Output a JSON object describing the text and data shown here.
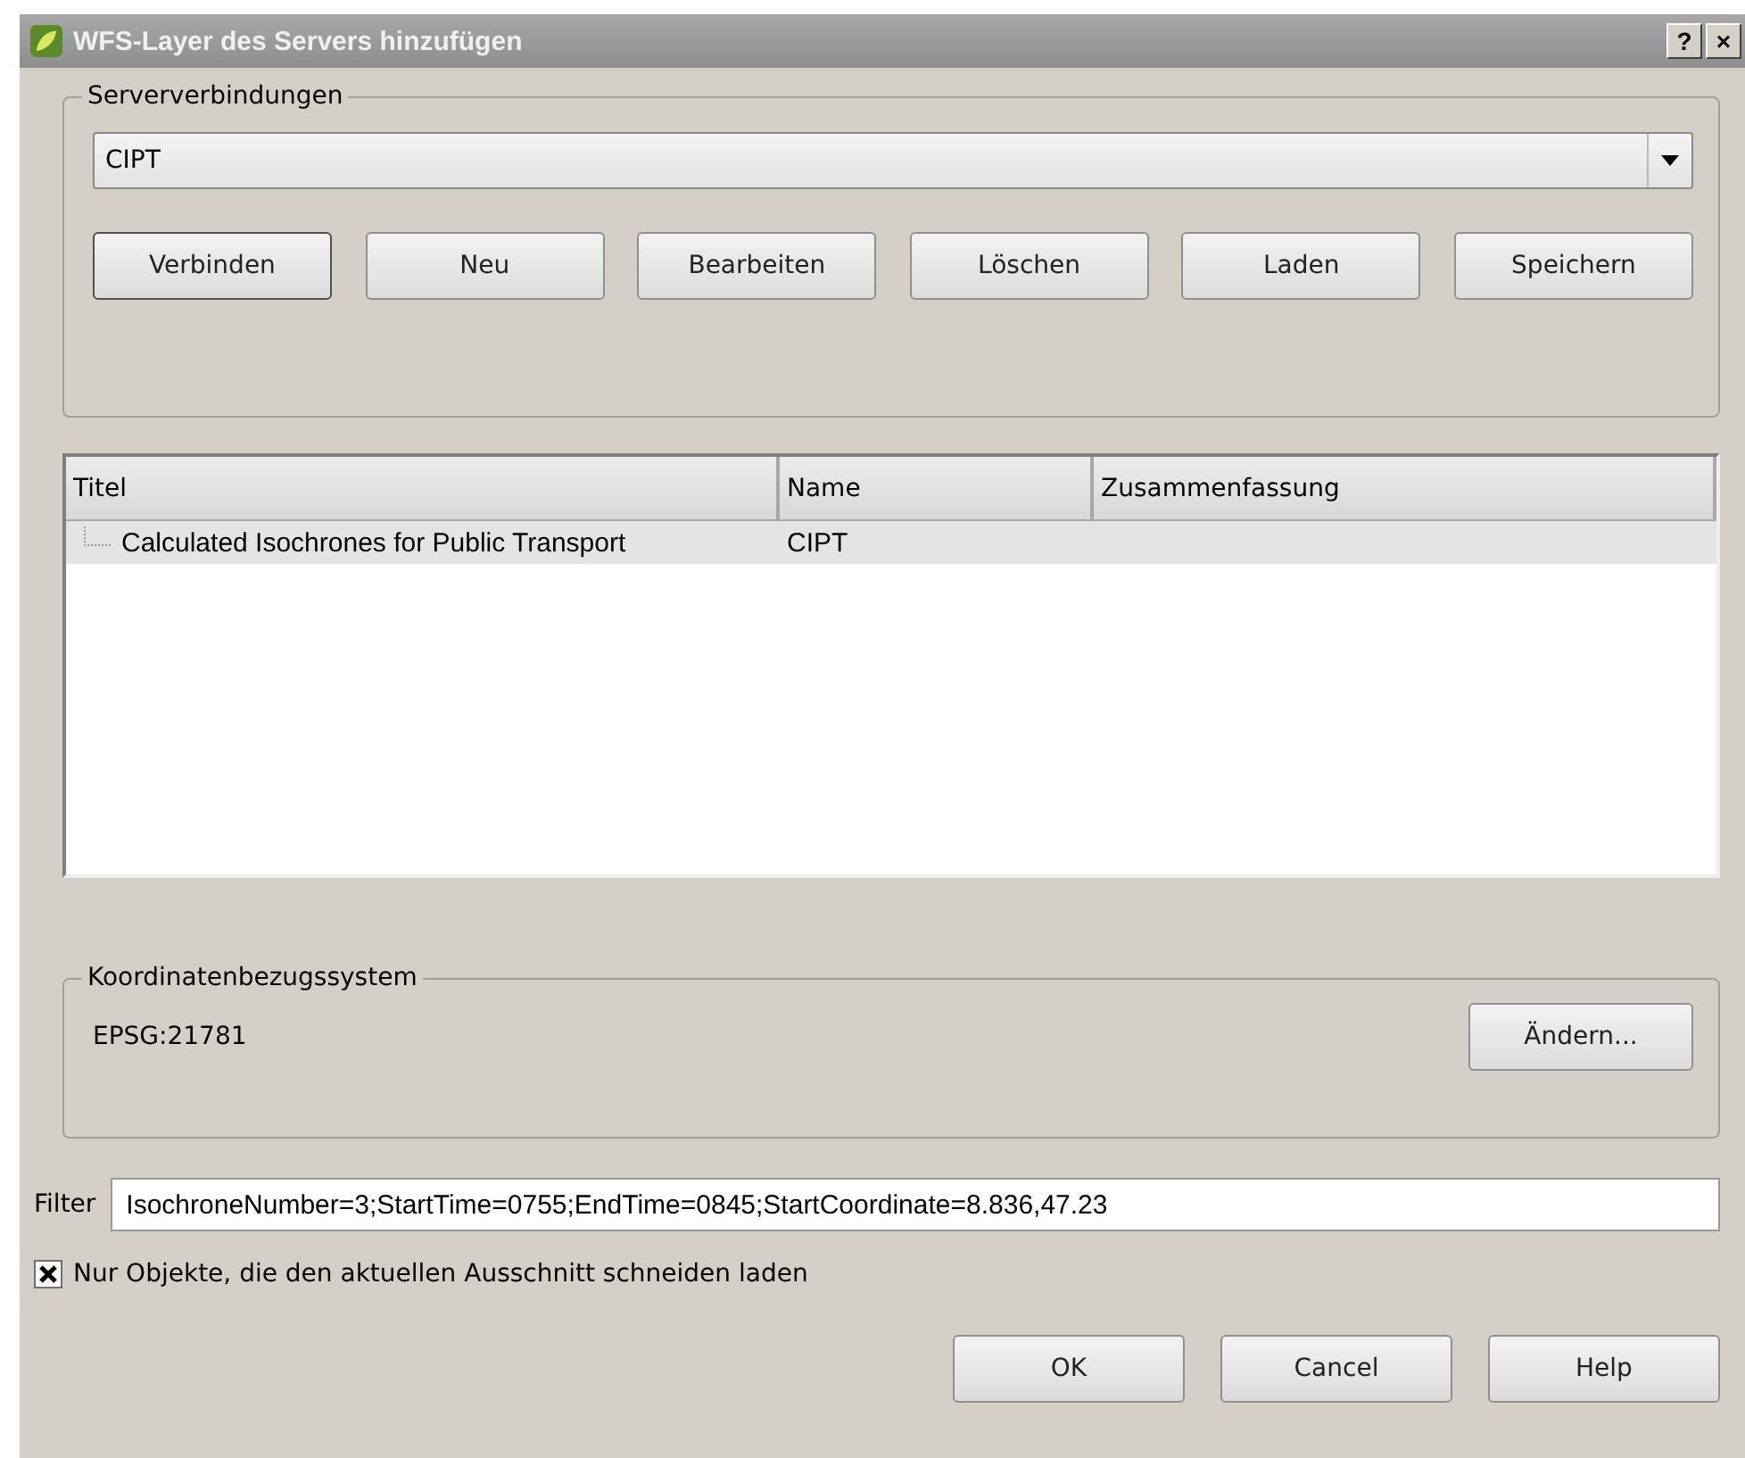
{
  "window": {
    "title": "WFS-Layer des Servers hinzufügen",
    "help_button": "?",
    "close_button": "×"
  },
  "connections": {
    "legend": "Serververbindungen",
    "selected": "CIPT",
    "buttons": [
      "Verbinden",
      "Neu",
      "Bearbeiten",
      "Löschen",
      "Laden",
      "Speichern"
    ]
  },
  "table": {
    "columns": [
      "Titel",
      "Name",
      "Zusammenfassung"
    ],
    "rows": [
      {
        "cells": [
          "Calculated Isochrones for Public Transport",
          "CIPT",
          ""
        ],
        "selected": true
      }
    ]
  },
  "crs": {
    "legend": "Koordinatenbezugssystem",
    "value": "EPSG:21781",
    "button": "Ändern..."
  },
  "filter": {
    "label": "Filter",
    "value": "IsochroneNumber=3;StartTime=0755;EndTime=0845;StartCoordinate=8.836,47.23"
  },
  "extent_checkbox": {
    "label": "Nur Objekte, die den aktuellen Ausschnitt schneiden laden",
    "checked": true
  },
  "buttons": [
    "OK",
    "Cancel",
    "Help"
  ]
}
